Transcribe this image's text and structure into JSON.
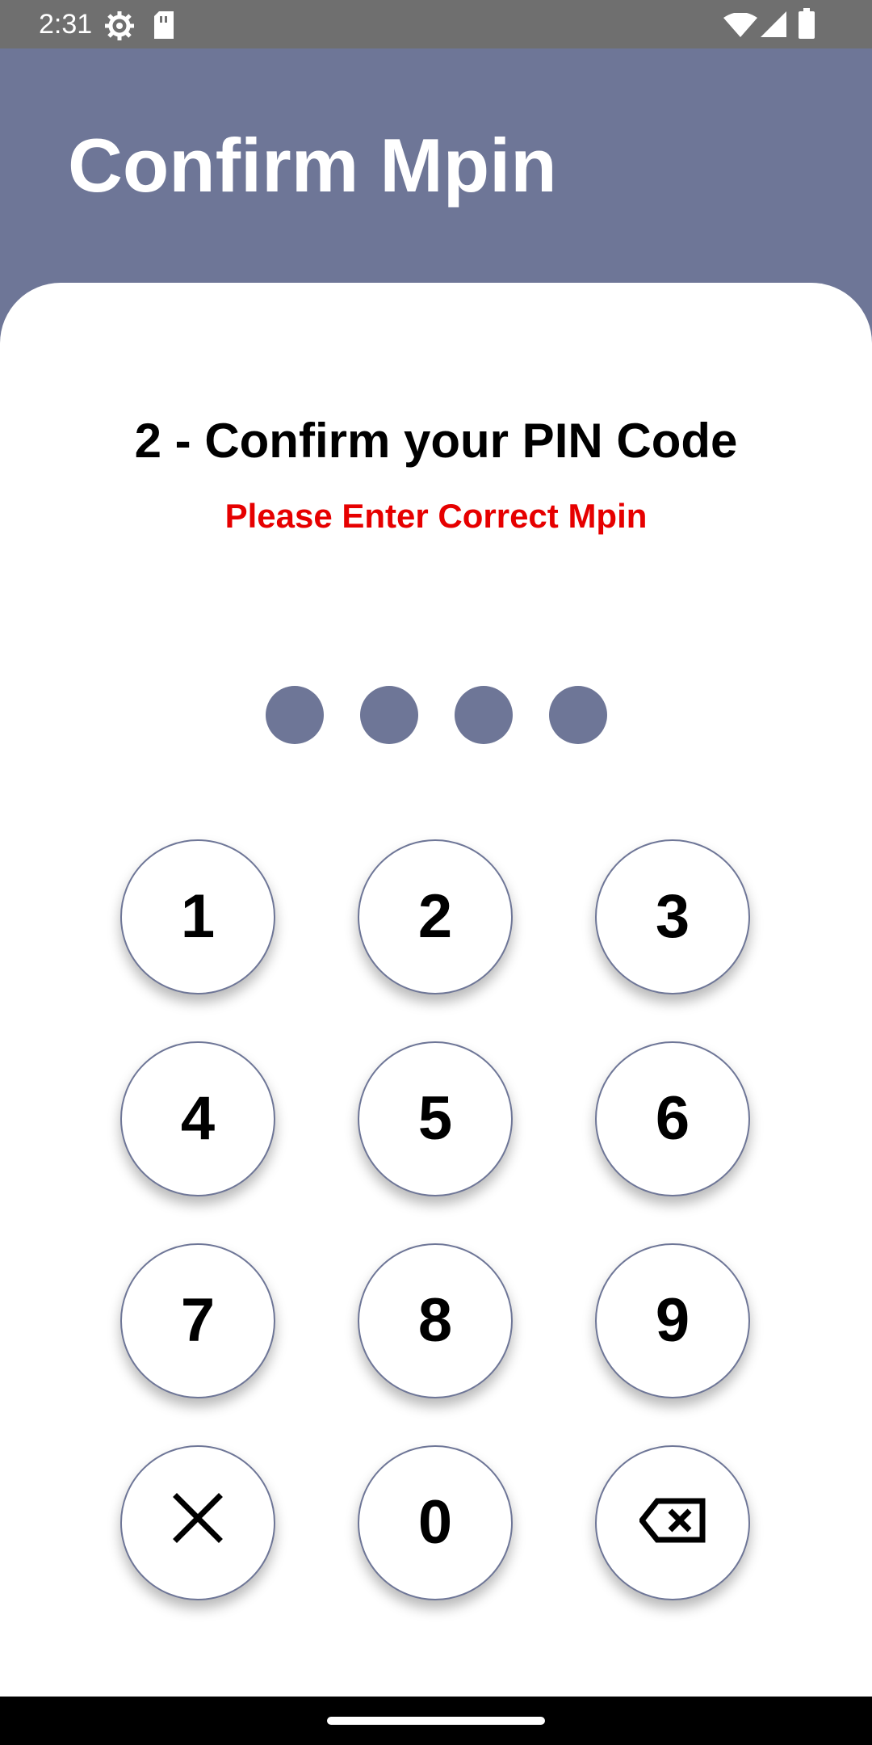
{
  "status_bar": {
    "time": "2:31",
    "icons": [
      "settings-icon",
      "sim-card-icon",
      "wifi-icon",
      "signal-icon",
      "battery-icon"
    ]
  },
  "header": {
    "title": "Confirm Mpin"
  },
  "main": {
    "step_title": "2 - Confirm your PIN Code",
    "error_message": "Please Enter Correct Mpin",
    "error_color": "#e60000",
    "accent_color": "#6e7697",
    "pin_length": 4
  },
  "keypad": {
    "keys": [
      "1",
      "2",
      "3",
      "4",
      "5",
      "6",
      "7",
      "8",
      "9",
      "",
      "0",
      ""
    ],
    "special_keys": {
      "clear": "close-icon",
      "backspace": "backspace-icon"
    }
  }
}
